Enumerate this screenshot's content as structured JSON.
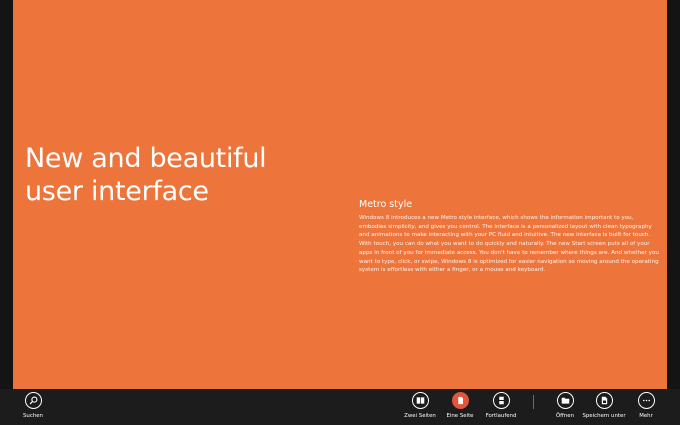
{
  "document": {
    "headline_line1": "New and beautiful",
    "headline_line2": "user interface",
    "article_title": "Metro style",
    "article_body": "Windows 8 introduces a new Metro style interface, which shows the information important to you, embodies simplicity, and gives you control. The interface is a personalized layout with clean typography and animations to make interacting with your PC fluid and intuitive. The new interface is built for touch. With touch, you can do what you want to do quickly and naturally. The new Start screen puts all of your apps in front of you for immediate access. You don't have to remember where things are. And whether you want to type, click, or swipe, Windows 8 is optimized for easier navigation so moving around the operating system is effortless with either a finger, or a mouse and keyboard."
  },
  "appbar": {
    "search_label": "Suchen",
    "two_pages_label": "Zwei Seiten",
    "one_page_label": "Eine Seite",
    "continuous_label": "Fortlaufend",
    "open_label": "Öffnen",
    "save_as_label": "Speichern unter",
    "more_label": "Mehr"
  },
  "colors": {
    "page_background": "#ed753b",
    "appbar_background": "#1c1c1c",
    "active_button": "#e2553a",
    "text": "#ffffff"
  },
  "icons": {
    "search": "magnifier-icon",
    "two_pages": "two-pages-icon",
    "one_page": "one-page-icon",
    "continuous": "continuous-icon",
    "open": "folder-icon",
    "save_as": "save-document-icon",
    "more": "more-dots-icon"
  }
}
